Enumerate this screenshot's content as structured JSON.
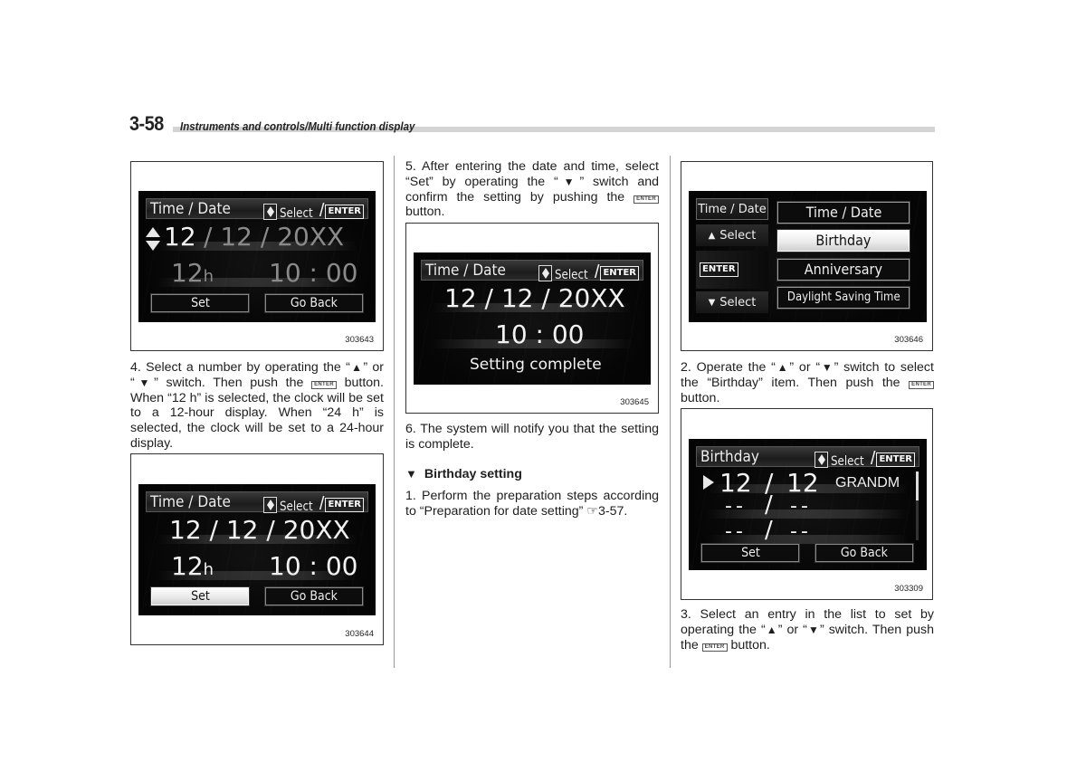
{
  "header": {
    "page_number": "3-58",
    "section_title": "Instruments and controls/Multi function display"
  },
  "common": {
    "select_hint": "Select",
    "slash": "/",
    "enter_label": "ENTER",
    "enter_inline": "ENTER",
    "up_tri": "▲",
    "down_tri": "▼"
  },
  "figures": {
    "fig_303643": {
      "id": "303643",
      "title": "Time / Date",
      "date_month": "12",
      "date_rest": "/  12  /  20XX",
      "clock_mode": "12",
      "clock_mode_unit": "h",
      "time": "10 : 00",
      "buttons": [
        "Set",
        "Go Back"
      ],
      "selected_button": null,
      "active_field": "month"
    },
    "fig_303644": {
      "id": "303644",
      "title": "Time / Date",
      "date": "12  /  12  /  20XX",
      "clock_mode": "12",
      "clock_mode_unit": "h",
      "time": "10 : 00",
      "buttons": [
        "Set",
        "Go Back"
      ],
      "selected_button": "Set"
    },
    "fig_303645": {
      "id": "303645",
      "title": "Time / Date",
      "date": "12  /  12  /  20XX",
      "time": "10 : 00",
      "status": "Setting complete"
    },
    "fig_303646": {
      "id": "303646",
      "side_title": "Time / Date",
      "side_up": "Select",
      "side_enter": "ENTER",
      "side_down": "Select",
      "menu_items": [
        "Time / Date",
        "Birthday",
        "Anniversary",
        "Daylight Saving Time"
      ],
      "selected_item": "Birthday"
    },
    "fig_303309": {
      "id": "303309",
      "title": "Birthday",
      "entries": [
        {
          "month": "12",
          "day": "12",
          "name": "GRANDM",
          "selected": true
        },
        {
          "month": "--",
          "day": "--",
          "name": "",
          "selected": false
        },
        {
          "month": "--",
          "day": "--",
          "name": "",
          "selected": false
        }
      ],
      "buttons": [
        "Set",
        "Go Back"
      ]
    }
  },
  "text": {
    "step4": {
      "p1": "4.  Select a number by operating the “",
      "p2": "” or “",
      "p3": "” switch. Then push the ",
      "p4": " button. When “12 h” is selected, the clock will be set to a 12-hour display. When “24 h” is selected, the clock will be set to a 24-hour display."
    },
    "step5": {
      "p1": "5.  After entering the date and time, select “Set” by operating the “",
      "p2": "” switch and confirm the setting by pushing the ",
      "p3": " button."
    },
    "step6": "6.  The system will notify you that the setting is complete.",
    "birthday_heading": "Birthday setting",
    "step1": "1.  Perform the preparation steps according to “Preparation for date setting” ☞3-57.",
    "step2": {
      "p1": "2.  Operate the “",
      "p2": "” or “",
      "p3": "” switch to select the “Birthday” item. Then push the ",
      "p4": " button."
    },
    "step3": {
      "p1": "3.  Select an entry in the list to set by operating the “",
      "p2": "” or “",
      "p3": "” switch. Then push the ",
      "p4": " button."
    }
  }
}
